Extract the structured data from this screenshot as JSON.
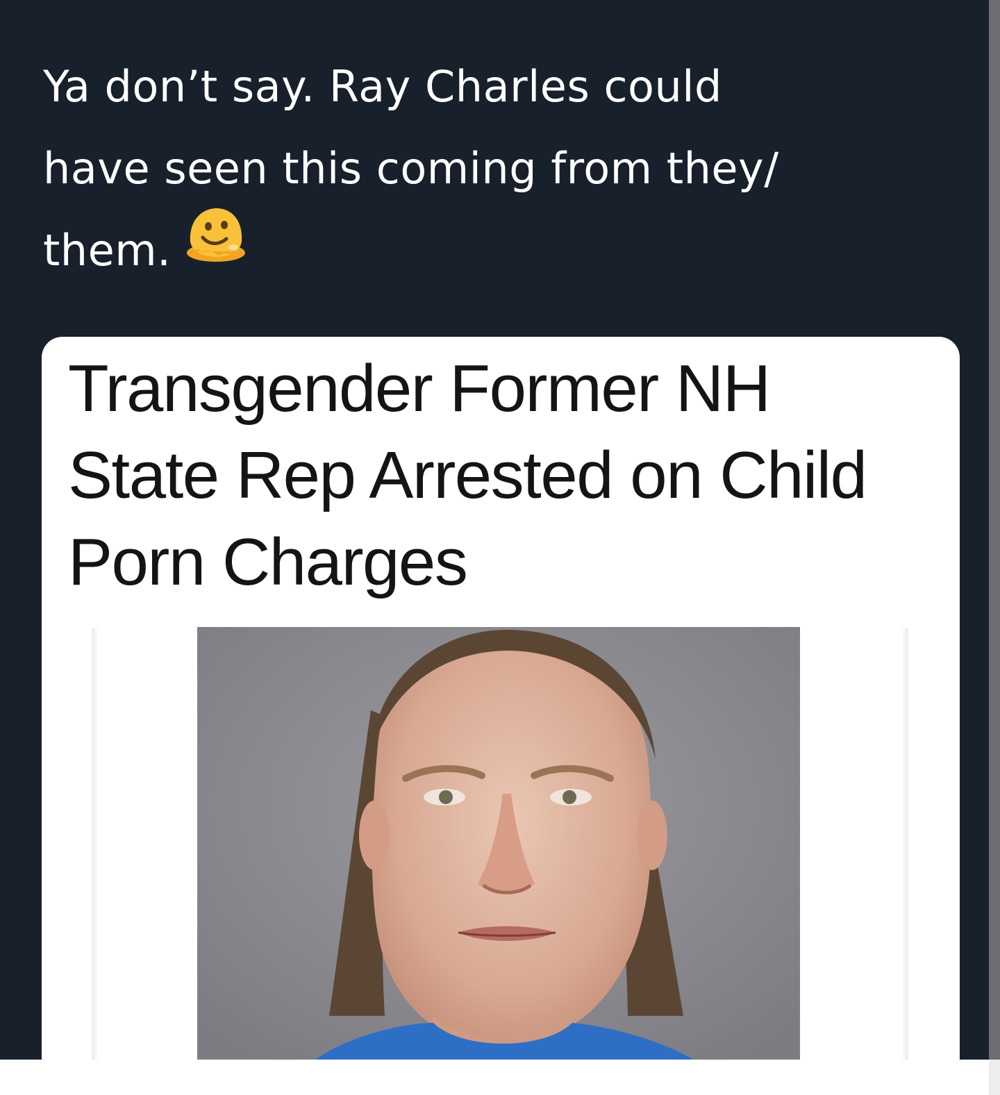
{
  "tweet": {
    "text_lines": [
      "Ya don’t say. Ray Charles could",
      "have seen this coming from they/",
      "them."
    ],
    "emoji": "melting-face-emoji"
  },
  "card": {
    "headline_lines": [
      "Transgender Former NH",
      "State Rep Arrested on Child",
      "Porn Charges"
    ],
    "image": "mugshot-photo"
  },
  "colors": {
    "background": "#18202c",
    "tweet_text": "#ffffff",
    "card_background": "#ffffff",
    "headline_text": "#141414",
    "photo_background": "#8e8e93",
    "shirt": "#2d6fc4",
    "emoji": "#f7c23a"
  }
}
